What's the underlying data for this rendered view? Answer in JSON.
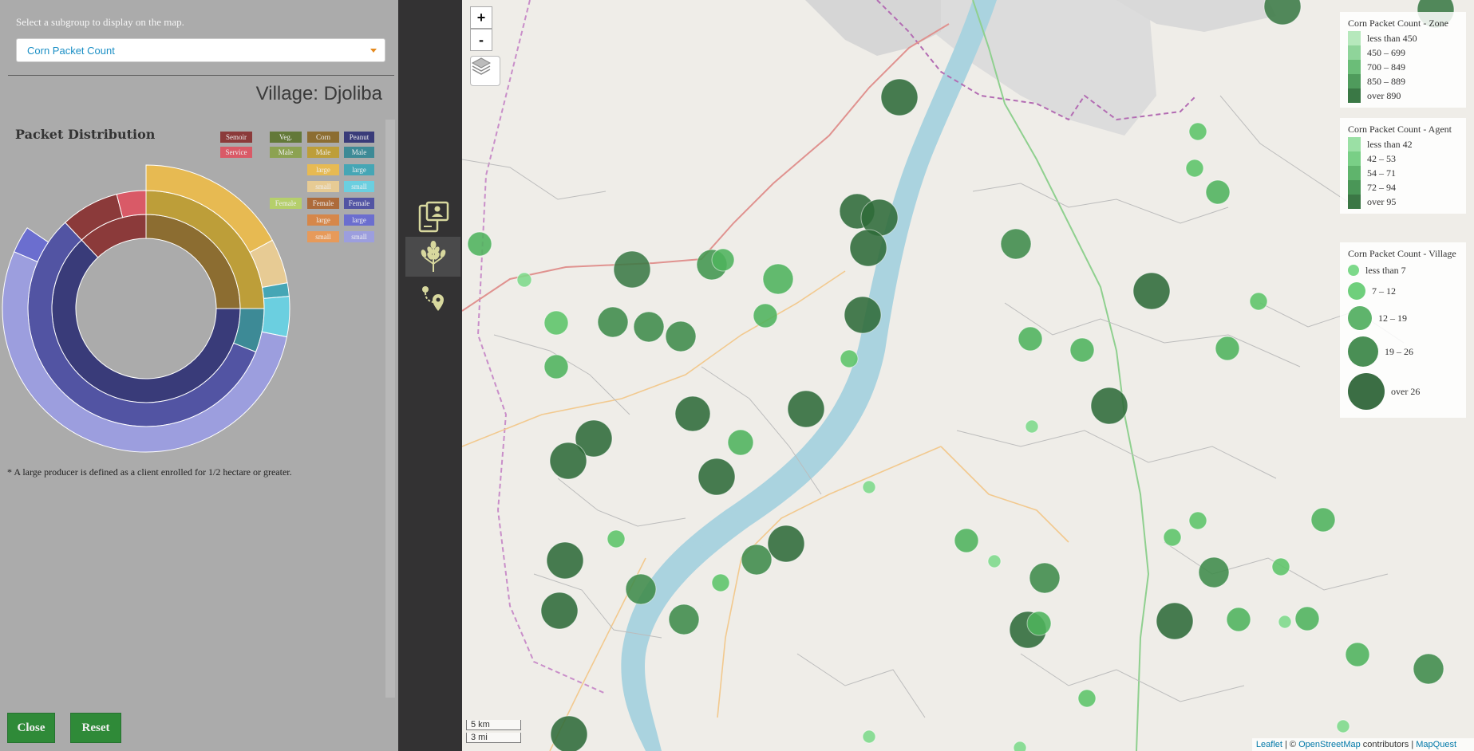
{
  "panel": {
    "hint": "Select a subgroup to display on the map.",
    "subgroup_value": "Corn Packet Count",
    "village_title": "Village: Djoliba",
    "distribution_title": "Packet Distribution",
    "footnote": "* A large producer is defined as a client enrolled for 1/2 hectare or greater.",
    "close_label": "Close",
    "reset_label": "Reset",
    "legend_chips": [
      {
        "label": "Semoir",
        "color": "#8b3a3a"
      },
      {
        "label": "Service",
        "color": "#d95a67"
      },
      {
        "label": "Veg.",
        "color": "#637939"
      },
      {
        "label": "Male",
        "color": "#8ca252"
      },
      {
        "label": "Female",
        "color": "#b5cf6b"
      },
      {
        "label": "Corn",
        "color": "#8c6d31"
      },
      {
        "label": "Male",
        "color": "#bd9e39"
      },
      {
        "label": "large",
        "color": "#e7ba52"
      },
      {
        "label": "small",
        "color": "#e7cb94"
      },
      {
        "label": "Female",
        "color": "#ad6b3a"
      },
      {
        "label": "large",
        "color": "#d6874a"
      },
      {
        "label": "small",
        "color": "#e79a5a"
      },
      {
        "label": "Peanut",
        "color": "#393b79"
      },
      {
        "label": "Male",
        "color": "#3d8a96"
      },
      {
        "label": "large",
        "color": "#45a6b5"
      },
      {
        "label": "small",
        "color": "#6bcfe0"
      },
      {
        "label": "Female",
        "color": "#5254a3"
      },
      {
        "label": "large",
        "color": "#6b6ecf"
      },
      {
        "label": "small",
        "color": "#9c9ede"
      }
    ]
  },
  "chart_data": {
    "type": "sunburst",
    "title": "Packet Distribution",
    "rings": [
      {
        "level": "crop",
        "segments": [
          {
            "label": "Corn",
            "value": 0.25,
            "color": "#8c6d31"
          },
          {
            "label": "Peanut",
            "value": 0.63,
            "color": "#393b79"
          },
          {
            "label": "Semoir",
            "value": 0.12,
            "color": "#8b3a3a"
          }
        ]
      },
      {
        "level": "gender",
        "segments": [
          {
            "label": "Corn Male",
            "value": 0.25,
            "color": "#bd9e39"
          },
          {
            "label": "Peanut Male",
            "value": 0.06,
            "color": "#3d8a96"
          },
          {
            "label": "Peanut Female",
            "value": 0.57,
            "color": "#5254a3"
          },
          {
            "label": "Semoir",
            "value": 0.08,
            "color": "#8b3a3a"
          },
          {
            "label": "Service",
            "value": 0.04,
            "color": "#d95a67"
          }
        ]
      },
      {
        "level": "size",
        "segments": [
          {
            "label": "Corn Male large",
            "value": 0.17,
            "color": "#e7ba52"
          },
          {
            "label": "Corn Male small",
            "value": 0.05,
            "color": "#e7cb94"
          },
          {
            "label": "Peanut Male large",
            "value": 0.015,
            "color": "#45a6b5"
          },
          {
            "label": "Peanut Male small",
            "value": 0.045,
            "color": "#6bcfe0"
          },
          {
            "label": "Peanut Female small",
            "value": 0.53,
            "color": "#9c9ede"
          },
          {
            "label": "Peanut Female large",
            "value": 0.03,
            "color": "#6b6ecf"
          }
        ]
      }
    ]
  },
  "sidebar": {
    "items": [
      {
        "name": "client-info-icon"
      },
      {
        "name": "wheat-icon"
      },
      {
        "name": "route-pin-icon"
      }
    ]
  },
  "map": {
    "zoom_in": "+",
    "zoom_out": "-",
    "scale_km": "5 km",
    "scale_mi": "3 mi",
    "attribution": {
      "leaflet": "Leaflet",
      "sep1": " | © ",
      "osm": "OpenStreetMap",
      "contrib": " contributors | ",
      "mq": "MapQuest"
    },
    "legend_zone": {
      "title": "Corn Packet Count - Zone",
      "rows": [
        {
          "label": "less than 450",
          "color": "#b6e8bc"
        },
        {
          "label": "450 – 699",
          "color": "#8fd49a"
        },
        {
          "label": "700 – 849",
          "color": "#6bbd78"
        },
        {
          "label": "850 – 889",
          "color": "#4f9b5c"
        },
        {
          "label": "over 890",
          "color": "#3a7845"
        }
      ]
    },
    "legend_agent": {
      "title": "Corn Packet Count - Agent",
      "rows": [
        {
          "label": "less than 42",
          "color": "#9be0a5"
        },
        {
          "label": "42 – 53",
          "color": "#79cf86"
        },
        {
          "label": "54 – 71",
          "color": "#5fb46c"
        },
        {
          "label": "72 – 94",
          "color": "#4a9657"
        },
        {
          "label": "over 95",
          "color": "#3b7745"
        }
      ]
    },
    "legend_village": {
      "title": "Corn Packet Count - Village",
      "rows": [
        {
          "label": "less than 7",
          "color": "#7dd98a"
        },
        {
          "label": "7 – 12",
          "color": "#6fcf7c"
        },
        {
          "label": "12 – 19",
          "color": "#5fb46c"
        },
        {
          "label": "19 – 26",
          "color": "#4a8f55"
        },
        {
          "label": "over 26",
          "color": "#3b6e44"
        }
      ]
    }
  }
}
